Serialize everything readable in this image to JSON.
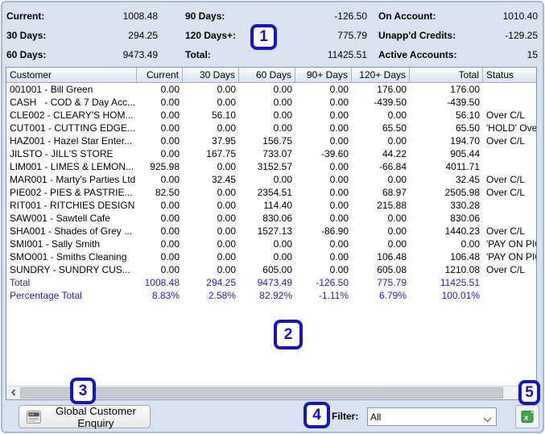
{
  "summary": {
    "col1": [
      {
        "label": "Current:",
        "value": "1008.48"
      },
      {
        "label": "30 Days:",
        "value": "294.25"
      },
      {
        "label": "60 Days:",
        "value": "9473.49"
      }
    ],
    "col2": [
      {
        "label": "90 Days:",
        "value": "-126.50"
      },
      {
        "label": "120 Days+:",
        "value": "775.79"
      },
      {
        "label": "Total:",
        "value": "11425.51"
      }
    ],
    "col3": [
      {
        "label": "On Account:",
        "value": "1010.40"
      },
      {
        "label": "Unapp'd Credits:",
        "value": "-129.25"
      },
      {
        "label": "Active Accounts:",
        "value": "15"
      }
    ]
  },
  "table": {
    "columns": [
      "Customer",
      "Current",
      "30 Days",
      "60 Days",
      "90+ Days",
      "120+ Days",
      "Total",
      "Status"
    ],
    "rows": [
      {
        "customer": "001001 - Bill Green",
        "current": "0.00",
        "d30": "0.00",
        "d60": "0.00",
        "d90": "0.00",
        "d120": "176.00",
        "total": "176.00",
        "status": ""
      },
      {
        "customer": "CASH   - COD & 7 Day Acc...",
        "current": "0.00",
        "d30": "0.00",
        "d60": "0.00",
        "d90": "0.00",
        "d120": "-439.50",
        "total": "-439.50",
        "status": ""
      },
      {
        "customer": "CLE002 - CLEARY'S HOM...",
        "current": "0.00",
        "d30": "56.10",
        "d60": "0.00",
        "d90": "0.00",
        "d120": "0.00",
        "total": "56.10",
        "status": "Over C/L"
      },
      {
        "customer": "CUT001 - CUTTING EDGE...",
        "current": "0.00",
        "d30": "0.00",
        "d60": "0.00",
        "d90": "0.00",
        "d120": "65.50",
        "total": "65.50",
        "status": "'HOLD' Over C/L"
      },
      {
        "customer": "HAZ001 - Hazel Star Enter...",
        "current": "0.00",
        "d30": "37.95",
        "d60": "156.75",
        "d90": "0.00",
        "d120": "0.00",
        "total": "194.70",
        "status": "Over C/L"
      },
      {
        "customer": "JILSTO - JILL'S STORE",
        "current": "0.00",
        "d30": "167.75",
        "d60": "733.07",
        "d90": "-39.60",
        "d120": "44.22",
        "total": "905.44",
        "status": ""
      },
      {
        "customer": "LIM001 - LIMES & LEMON...",
        "current": "925.98",
        "d30": "0.00",
        "d60": "3152.57",
        "d90": "0.00",
        "d120": "-66.84",
        "total": "4011.71",
        "status": ""
      },
      {
        "customer": "MAR001 - Marty's Parties Ltd",
        "current": "0.00",
        "d30": "32.45",
        "d60": "0.00",
        "d90": "0.00",
        "d120": "0.00",
        "total": "32.45",
        "status": "Over C/L"
      },
      {
        "customer": "PIE002 - PIES & PASTRIE...",
        "current": "82.50",
        "d30": "0.00",
        "d60": "2354.51",
        "d90": "0.00",
        "d120": "68.97",
        "total": "2505.98",
        "status": "Over C/L"
      },
      {
        "customer": "RIT001 - RITCHIES DESIGN",
        "current": "0.00",
        "d30": "0.00",
        "d60": "114.40",
        "d90": "0.00",
        "d120": "215.88",
        "total": "330.28",
        "status": ""
      },
      {
        "customer": "SAW001 - Sawtell Cafe",
        "current": "0.00",
        "d30": "0.00",
        "d60": "830.06",
        "d90": "0.00",
        "d120": "0.00",
        "total": "830.06",
        "status": ""
      },
      {
        "customer": "SHA001 - Shades of Grey ...",
        "current": "0.00",
        "d30": "0.00",
        "d60": "1527.13",
        "d90": "-86.90",
        "d120": "0.00",
        "total": "1440.23",
        "status": "Over C/L"
      },
      {
        "customer": "SMI001 - Sally Smith",
        "current": "0.00",
        "d30": "0.00",
        "d60": "0.00",
        "d90": "0.00",
        "d120": "0.00",
        "total": "0.00",
        "status": "'PAY ON PICKUP'"
      },
      {
        "customer": "SMO001 - Smiths Cleaning",
        "current": "0.00",
        "d30": "0.00",
        "d60": "0.00",
        "d90": "0.00",
        "d120": "106.48",
        "total": "106.48",
        "status": "'PAY ON PICKUP'"
      },
      {
        "customer": "SUNDRY - SUNDRY CUS...",
        "current": "0.00",
        "d30": "0.00",
        "d60": "605.00",
        "d90": "0.00",
        "d120": "605.08",
        "total": "1210.08",
        "status": "Over C/L"
      }
    ],
    "total_row": {
      "customer": "Total",
      "current": "1008.48",
      "d30": "294.25",
      "d60": "9473.49",
      "d90": "-126.50",
      "d120": "775.79",
      "total": "11425.51",
      "status": ""
    },
    "percentage_row": {
      "customer": "Percentage Total",
      "current": "8.83%",
      "d30": "2.58%",
      "d60": "82.92%",
      "d90": "-1.11%",
      "d120": "6.79%",
      "total": "100.01%",
      "status": ""
    }
  },
  "footer": {
    "enquiry_button_label": "Global Customer Enquiry",
    "filter_label": "Filter:",
    "filter_value": "All"
  },
  "annotations": {
    "a1": "1",
    "a2": "2",
    "a3": "3",
    "a4": "4",
    "a5": "5"
  },
  "icons": {
    "enquiry_button": "card-file-icon",
    "excel_button": "excel-file-icon",
    "filter_dropdown": "chevron-down-icon",
    "scrollbar_left": "chevron-left-icon"
  },
  "colors": {
    "annotation_blue": "#1414cf",
    "totals_text": "#2121cc",
    "window_background": "#d9e3f0",
    "excel_green": "#44a547"
  }
}
